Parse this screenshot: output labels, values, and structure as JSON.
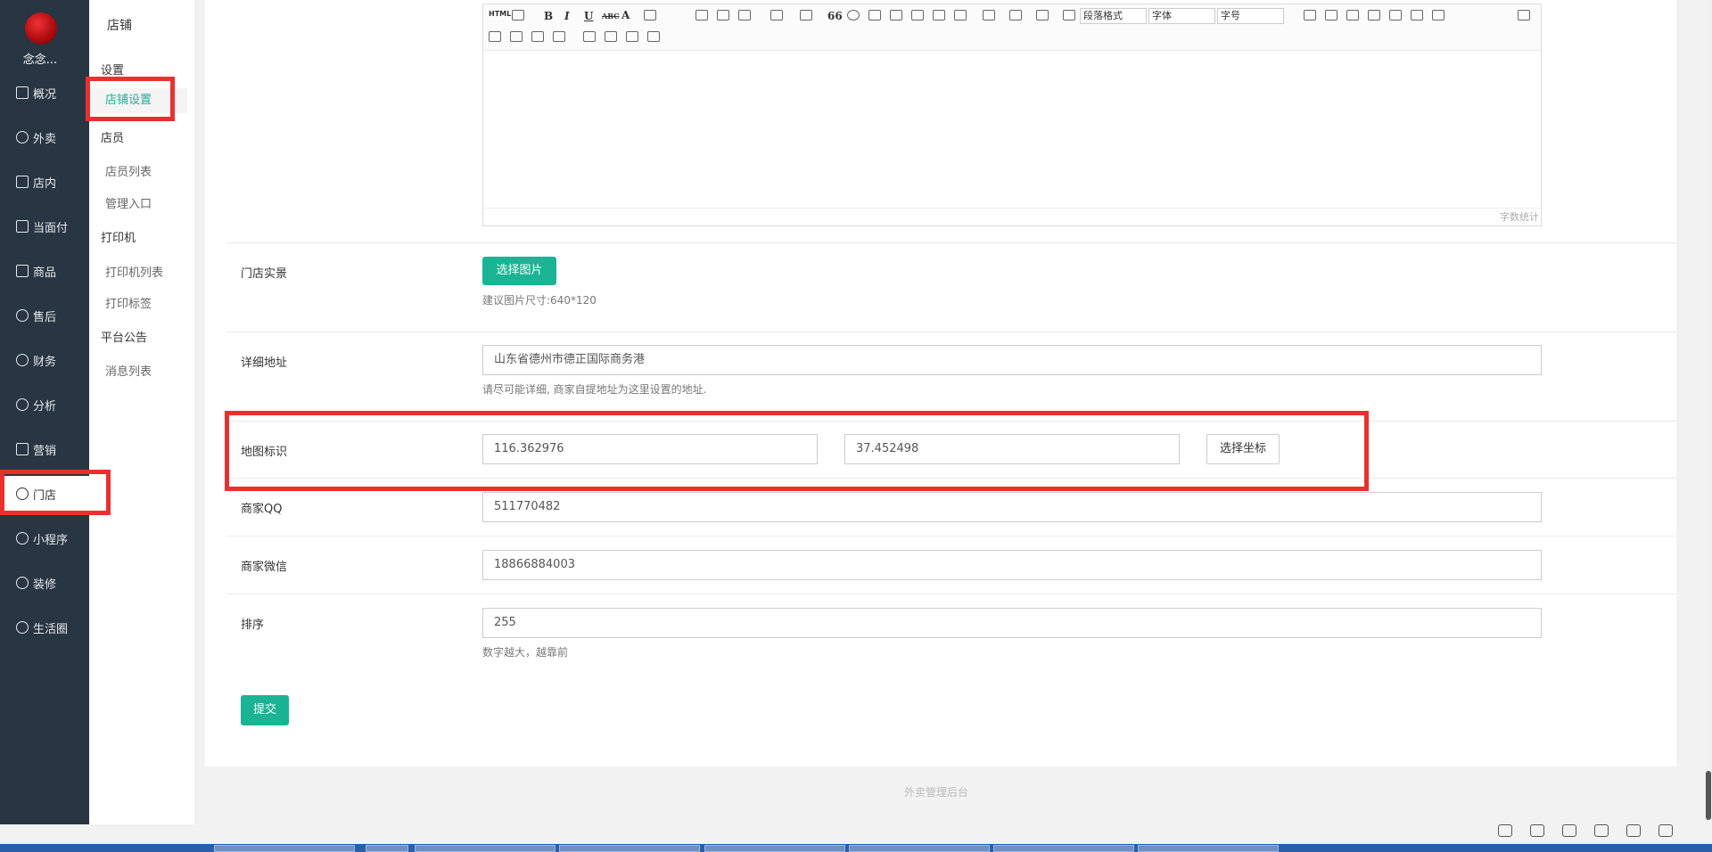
{
  "app": {
    "name": "念念...",
    "footer": "外卖管理后台"
  },
  "left_nav": [
    {
      "label": "概况",
      "icon": "dashboard-icon"
    },
    {
      "label": "外卖",
      "icon": "delivery-icon"
    },
    {
      "label": "店内",
      "icon": "store-icon"
    },
    {
      "label": "当面付",
      "icon": "receipt-icon"
    },
    {
      "label": "商品",
      "icon": "bag-icon"
    },
    {
      "label": "售后",
      "icon": "refund-icon"
    },
    {
      "label": "财务",
      "icon": "yen-icon"
    },
    {
      "label": "分析",
      "icon": "chart-icon"
    },
    {
      "label": "营销",
      "icon": "flag-icon"
    },
    {
      "label": "门店",
      "icon": "gear-icon",
      "active": true
    },
    {
      "label": "小程序",
      "icon": "gear-icon"
    },
    {
      "label": "装修",
      "icon": "gear-icon"
    },
    {
      "label": "生活圈",
      "icon": "gear-icon"
    }
  ],
  "sub_nav": {
    "title": "店铺",
    "groups": [
      {
        "label": "设置",
        "items": [
          "店铺设置"
        ]
      },
      {
        "label": "店员",
        "items": [
          "店员列表",
          "管理入口"
        ]
      },
      {
        "label": "打印机",
        "items": [
          "打印机列表",
          "打印标签"
        ]
      },
      {
        "label": "平台公告",
        "items": [
          "消息列表"
        ]
      }
    ],
    "active_item": "店铺设置"
  },
  "editor": {
    "paragraph_format": "段落格式",
    "font": "字体",
    "font_size": "字号",
    "word_count": "字数统计",
    "html_label": "HTML",
    "bold": "B",
    "italic": "I",
    "underline": "U",
    "strike": "ABC",
    "font_color": "A",
    "quote": "66"
  },
  "form": {
    "photo": {
      "label": "门店实景",
      "button": "选择图片",
      "help": "建议图片尺寸:640*120"
    },
    "address": {
      "label": "详细地址",
      "value": "山东省德州市德正国际商务港",
      "help": "请尽可能详细, 商家自提地址为这里设置的地址."
    },
    "map": {
      "label": "地图标识",
      "lng": "116.362976",
      "lat": "37.452498",
      "button": "选择坐标"
    },
    "qq": {
      "label": "商家QQ",
      "value": "511770482"
    },
    "wechat": {
      "label": "商家微信",
      "value": "18866884003"
    },
    "sort": {
      "label": "排序",
      "value": "255",
      "help": "数字越大，越靠前"
    },
    "submit": "提交"
  },
  "colors": {
    "primary": "#1ab394",
    "sidebar": "#283542",
    "highlight": "#e8312f"
  }
}
